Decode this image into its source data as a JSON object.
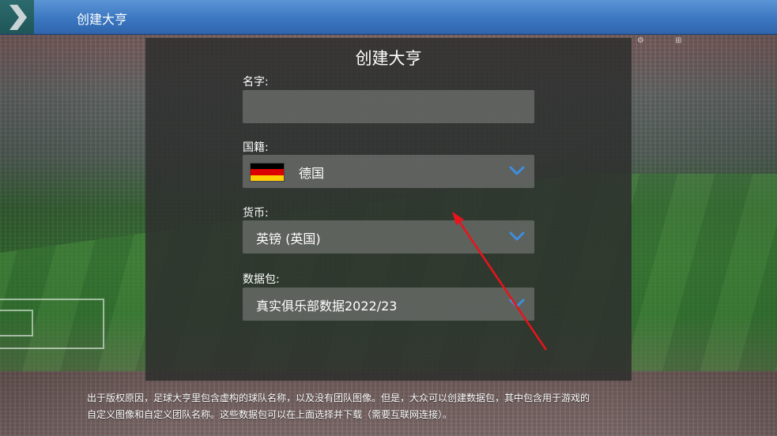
{
  "app": {
    "topbar_title": "创建大亨"
  },
  "dialog": {
    "title": "创建大亨",
    "name": {
      "label": "名字:",
      "value": "",
      "placeholder": ""
    },
    "nationality": {
      "label": "国籍:",
      "value": "德国",
      "flag_icon": "germany-flag-icon",
      "flag_colors": [
        "#000000",
        "#dd0000",
        "#ffce00"
      ]
    },
    "currency": {
      "label": "货币:",
      "value": "英镑 (英国)"
    },
    "data_pack": {
      "label": "数据包:",
      "value": "真实俱乐部数据2022/23"
    }
  },
  "footer": {
    "line1": "出于版权原因，足球大亨里包含虚构的球队名称，以及没有团队图像。但是，大众可以创建数据包，其中包含用于游戏的",
    "line2": "自定义图像和自定义团队名称。这些数据包可以在上面选择并下载（需要互联网连接）。"
  },
  "icons": {
    "back": "chevron-right-icon",
    "dropdown": "chevron-down-icon"
  },
  "colors": {
    "topbar": "#3b77c0",
    "back_button": "#1f5658",
    "accent_chevron": "#3d8ee0",
    "annotation_arrow": "#e8141b"
  }
}
